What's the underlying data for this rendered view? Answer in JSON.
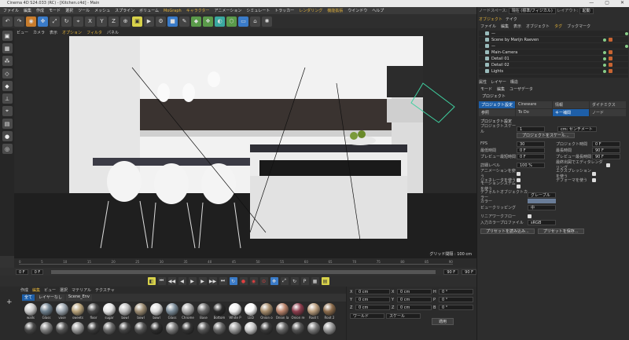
{
  "title": "Cinema 4D S24.033 (RC) - [Kitchen.c4d] - Main",
  "window_controls": [
    "—",
    "▢",
    "✕"
  ],
  "menus": [
    "ファイル",
    "編集",
    "作成",
    "モード",
    "選択",
    "ツール",
    "メッシュ",
    "スプライン",
    "ボリューム",
    "MoGraph",
    "キャラクター",
    "アニメーション",
    "シミュレート",
    "トラッカー",
    "レンダリング",
    "機能拡張",
    "ウインドウ",
    "ヘルプ"
  ],
  "right_menu": {
    "node_space_label": "ノードスペース:",
    "node_space_value": "現在 (標準/フィジカル)",
    "layout_label": "レイアウト:",
    "layout_value": "起動"
  },
  "viewport_menu": [
    "ビュー",
    "カメラ",
    "表示",
    "オプション",
    "フィルタ",
    "パネル"
  ],
  "grid_label": "グリッド間隔 : 100 cm",
  "timeline": {
    "ticks": [
      "0",
      "5",
      "10",
      "15",
      "20",
      "25",
      "30",
      "35",
      "40",
      "45",
      "50",
      "55",
      "60",
      "65",
      "70",
      "75",
      "80",
      "85",
      "90"
    ],
    "start": "0 F",
    "start2": "0 F",
    "end": "90 F",
    "end2": "90 F",
    "current": "0 F"
  },
  "material_menu": [
    "作成",
    "編集",
    "ビュー",
    "選択",
    "マテリアル",
    "テクスチャ"
  ],
  "material_filters": [
    "全て",
    "レイヤーなし",
    "Scene_Env"
  ],
  "materials": [
    {
      "name": "walls",
      "color": "#c9c9c9"
    },
    {
      "name": "Glass",
      "color": "#6d7f8d"
    },
    {
      "name": "vase",
      "color": "#9aa4ad"
    },
    {
      "name": "sweets",
      "color": "#b7a27a"
    },
    {
      "name": "floor",
      "color": "#494949"
    },
    {
      "name": "sugar",
      "color": "#e6e6e6"
    },
    {
      "name": "bowl",
      "color": "#bfbfbf"
    },
    {
      "name": "bowl",
      "color": "#9b8b72"
    },
    {
      "name": "bowl",
      "color": "#ddd"
    },
    {
      "name": "Glass",
      "color": "#7a8b98"
    },
    {
      "name": "Chrome",
      "color": "#a8a8a8"
    },
    {
      "name": "Base",
      "color": "#6a6a6a"
    },
    {
      "name": "Bottom",
      "color": "#2a2a2a"
    },
    {
      "name": "White P",
      "color": "#efefef"
    },
    {
      "name": "LED",
      "color": "#fafafa"
    },
    {
      "name": "Onion o",
      "color": "#a48a6a"
    },
    {
      "name": "Onion la",
      "color": "#b8826a"
    },
    {
      "name": "Onion re",
      "color": "#8c3c4c"
    },
    {
      "name": "Root t",
      "color": "#b89c7c"
    },
    {
      "name": "Root 2",
      "color": "#8c6c4c"
    },
    {
      "name": "",
      "color": "#4a4a4a"
    },
    {
      "name": "",
      "color": "#808080"
    },
    {
      "name": "",
      "color": "#555"
    },
    {
      "name": "",
      "color": "#9a9a9a"
    },
    {
      "name": "",
      "color": "#3a3a3a"
    },
    {
      "name": "",
      "color": "#6a6a6a"
    },
    {
      "name": "",
      "color": "#444"
    },
    {
      "name": "",
      "color": "#555"
    },
    {
      "name": "",
      "color": "#2c2c2c"
    },
    {
      "name": "",
      "color": "#7a7a7a"
    },
    {
      "name": "",
      "color": "#333"
    },
    {
      "name": "",
      "color": "#555"
    },
    {
      "name": "",
      "color": "#666"
    },
    {
      "name": "",
      "color": "#999"
    },
    {
      "name": "",
      "color": "#c9c9c9"
    },
    {
      "name": "",
      "color": "#3a3a3a"
    },
    {
      "name": "",
      "color": "#666"
    },
    {
      "name": "",
      "color": "#555"
    },
    {
      "name": "",
      "color": "#777"
    },
    {
      "name": "",
      "color": "#999"
    }
  ],
  "coords": {
    "rows": [
      {
        "a": "X",
        "v1": "0 cm",
        "b": "X",
        "v2": "0 cm",
        "c": "H",
        "v3": "0 °"
      },
      {
        "a": "Y",
        "v1": "0 cm",
        "b": "Y",
        "v2": "0 cm",
        "c": "P",
        "v3": "0 °"
      },
      {
        "a": "Z",
        "v1": "0 cm",
        "b": "Z",
        "v2": "0 cm",
        "c": "B",
        "v3": "0 °"
      }
    ],
    "world": "ワールド",
    "scale": "スケール",
    "apply": "適用"
  },
  "obj_tabs": [
    "オブジェクト",
    "テイク"
  ],
  "obj_menu": [
    "ファイル",
    "編集",
    "表示",
    "オブジェクト",
    "タグ",
    "ブックマーク"
  ],
  "objects": [
    "—",
    "Scene by Marijn Raeven",
    "—",
    "Main-Camera",
    "Detail 01",
    "Detail 02",
    "Lights"
  ],
  "attr_tabs": [
    "属性",
    "レイヤー",
    "構造"
  ],
  "attr_menu": [
    "モード",
    "編集",
    "ユーザデータ"
  ],
  "attr_head": "プロジェクト",
  "proj_tabs": [
    "プロジェクト設定",
    "Cineware",
    "情報",
    "ダイナミクス",
    "参照",
    "To Do",
    "キー補間",
    "ノード"
  ],
  "props": {
    "section": "プロジェクト設定",
    "scale_label": "プロジェクトスケール",
    "scale_value": "1",
    "scale_unit": "cm: センチメートル",
    "scale_btn": "プロジェクトをスケール...",
    "fps_label": "FPS",
    "fps_value": "30",
    "time_label": "プロジェクト時間",
    "time_value": "0 F",
    "min_label": "最低時間",
    "min_value": "0 F",
    "max_label": "最長時間",
    "max_value": "90 F",
    "pmin_label": "プレビュー最短時間",
    "pmin_value": "0 F",
    "pmax_label": "プレビュー最長時間",
    "pmax_value": "90 F",
    "lod_label": "詳細レベル",
    "lod_value": "100 %",
    "render_lod_label": "最終出図でエディタレンダリング",
    "anim_label": "アニメーションを使う",
    "expr_label": "エクスプレッションを使う",
    "gen_label": "ジェネレータを使う",
    "deform_label": "デフォーマを使う",
    "motion_label": "モーションシステムを使う",
    "default_color_label": "デフォルトオブジェクトカラー",
    "default_color_value": "グレーブルー",
    "color_label": "カラー",
    "clip_label": "ビュークリッピング",
    "clip_value": "中",
    "linear_label": "リニアワークフロー",
    "profile_label": "入力カラープロファイル",
    "profile_value": "sRGB",
    "load_btn": "プリセットを読み込み...",
    "save_btn": "プリセットを保存..."
  }
}
